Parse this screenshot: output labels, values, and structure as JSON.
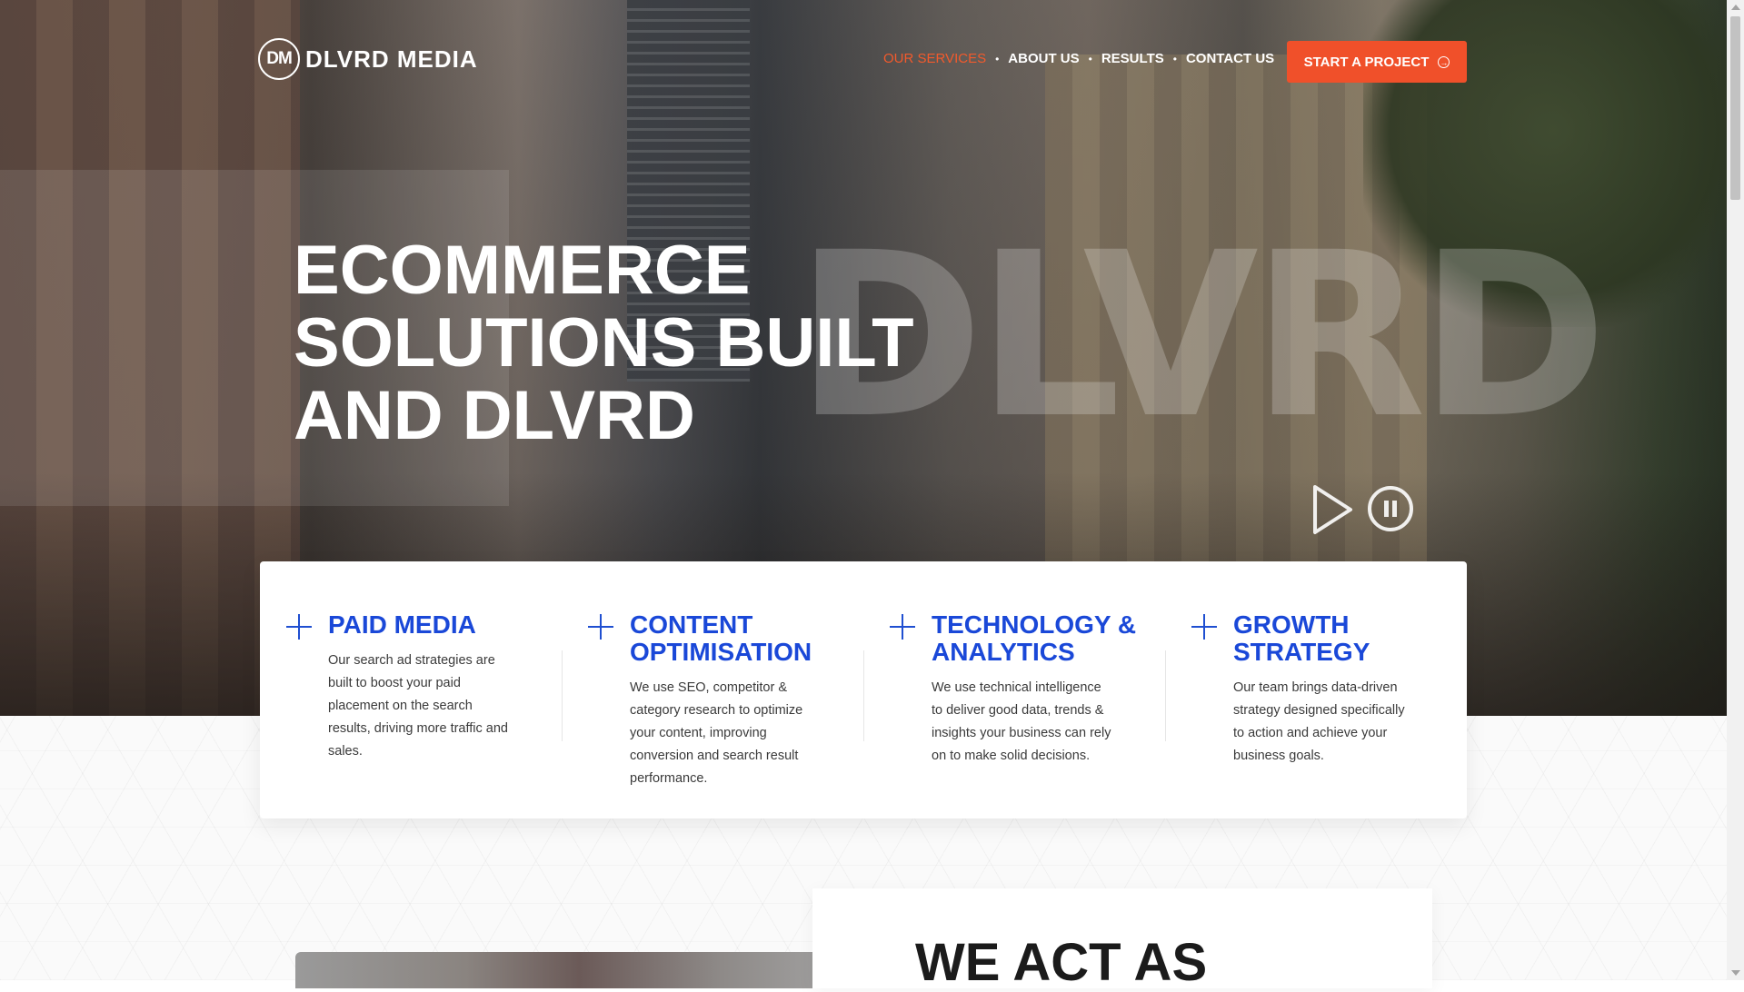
{
  "brand": {
    "logo_mark": "DM",
    "logo_text": "DLVRD MEDIA"
  },
  "nav": {
    "items": [
      {
        "label": "OUR SERVICES",
        "active": true
      },
      {
        "label": "ABOUT US"
      },
      {
        "label": "RESULTS"
      },
      {
        "label": "CONTACT US"
      }
    ],
    "separator": "•",
    "cta_label": "START A PROJECT",
    "cta_icon": "arrow-circle-right-icon"
  },
  "hero": {
    "title_lines": [
      "ECOMMERCE",
      "SOLUTIONS BUILT",
      "AND DLVRD"
    ],
    "watermark": "DLVRD",
    "controls": [
      "play-icon",
      "pause-icon"
    ]
  },
  "services": [
    {
      "title": "PAID MEDIA",
      "description": "Our search ad strategies are built to boost your paid placement on the search results, driving more traffic and sales."
    },
    {
      "title": "CONTENT OPTIMISATION",
      "description": "We use SEO, competitor & category research to optimize your content, improving conversion and search result performance."
    },
    {
      "title": "TECHNOLOGY & ANALYTICS",
      "description": "We use technical intelligence to deliver good data, trends & insights your business can rely on to make solid decisions."
    },
    {
      "title": "GROWTH STRATEGY",
      "description": "Our team brings data-driven strategy designed specifically to action and achieve your business goals."
    }
  ],
  "about": {
    "heading": "WE ACT AS"
  },
  "colors": {
    "accent": "#f0502a",
    "service_blue": "#1a48d8",
    "heading_dark": "#1b1b1b"
  }
}
